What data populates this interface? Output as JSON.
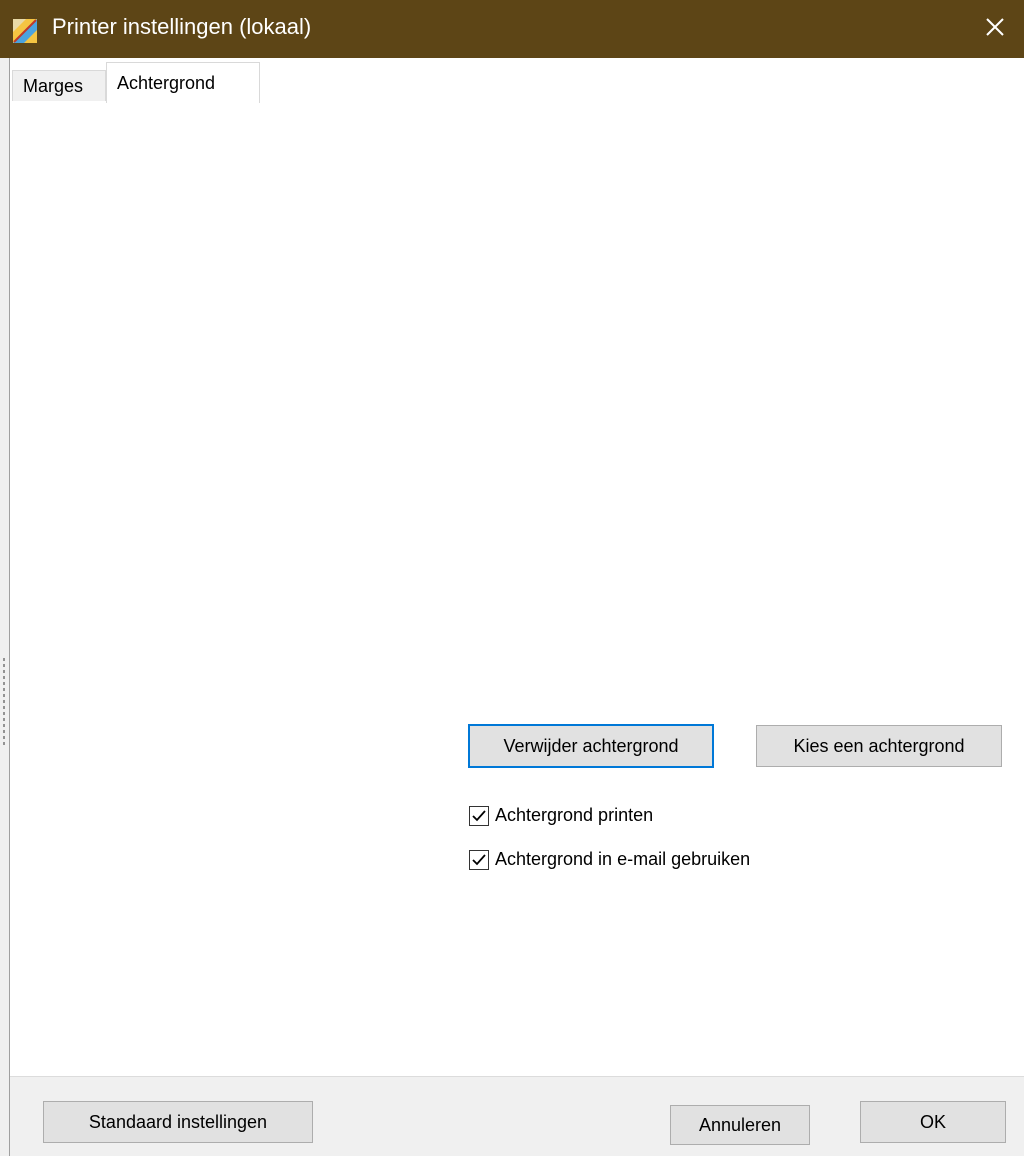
{
  "window": {
    "title": "Printer instellingen (lokaal)"
  },
  "tabs": [
    {
      "label": "Marges",
      "active": false
    },
    {
      "label": "Achtergrond",
      "active": true
    }
  ],
  "background_tab": {
    "remove_button_label": "Verwijder achtergrond",
    "choose_button_label": "Kies een achtergrond",
    "print_checkbox_label": "Achtergrond printen",
    "print_checkbox_checked": true,
    "email_checkbox_label": "Achtergrond in e-mail gebruiken",
    "email_checkbox_checked": true
  },
  "footer": {
    "defaults_button_label": "Standaard instellingen",
    "cancel_button_label": "Annuleren",
    "ok_button_label": "OK"
  },
  "colors": {
    "titlebar": "#5d4516",
    "focus_border": "#0078d7",
    "button_face": "#e1e1e1"
  },
  "icons": {
    "app": "printer-settings-app-icon",
    "close": "close-icon",
    "check": "check-icon"
  }
}
